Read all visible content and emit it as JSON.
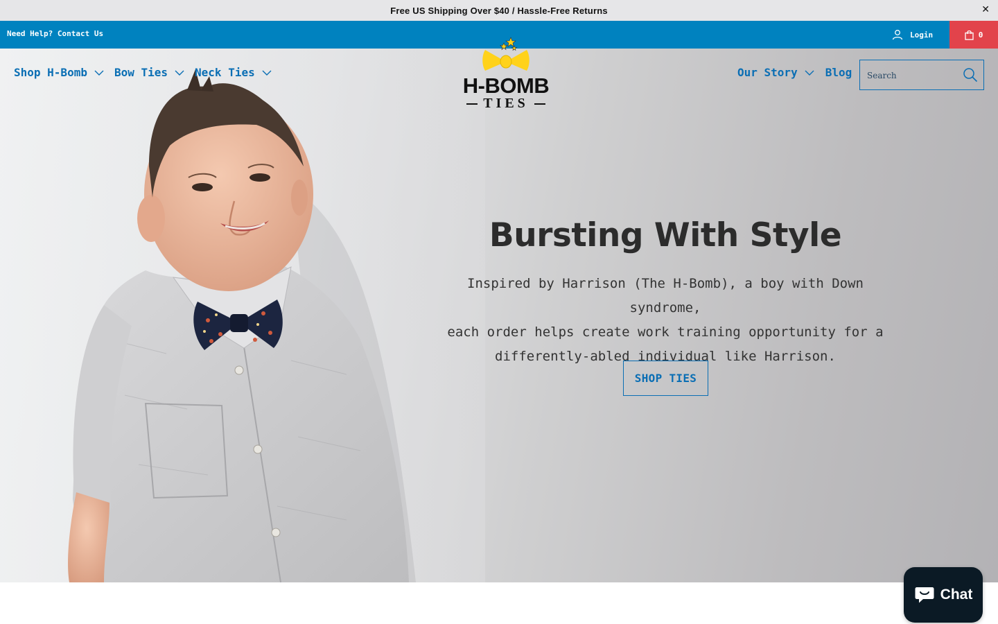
{
  "announcement": {
    "text": "Free US Shipping Over $40 / Hassle-Free Returns",
    "close_icon": "close-icon"
  },
  "topbar": {
    "help_link": "Need Help? Contact Us",
    "login_label": "Login",
    "cart_count": "0"
  },
  "nav": {
    "left": [
      {
        "label": "Shop H-Bomb",
        "has_dropdown": true
      },
      {
        "label": "Bow Ties",
        "has_dropdown": true
      },
      {
        "label": "Neck Ties",
        "has_dropdown": true
      }
    ],
    "right": [
      {
        "label": "Our Story",
        "has_dropdown": true
      },
      {
        "label": "Blog",
        "has_dropdown": false
      }
    ]
  },
  "logo": {
    "word": "H-BOMB",
    "sub": "TIES"
  },
  "search": {
    "placeholder": "Search"
  },
  "hero": {
    "headline": "Bursting With Style",
    "lines": [
      "Inspired by Harrison (The H-Bomb), a boy with Down syndrome,",
      "each order helps create work training opportunity for a",
      "differently-abled individual like Harrison."
    ],
    "cta_label": "SHOP TIES"
  },
  "chat": {
    "label": "Chat"
  },
  "colors": {
    "brand_blue": "#0082bf",
    "link_blue": "#0a6eb4",
    "cart_red": "#e2434b",
    "logo_yellow": "#ffd21a",
    "chat_dark": "#0b1a25"
  }
}
